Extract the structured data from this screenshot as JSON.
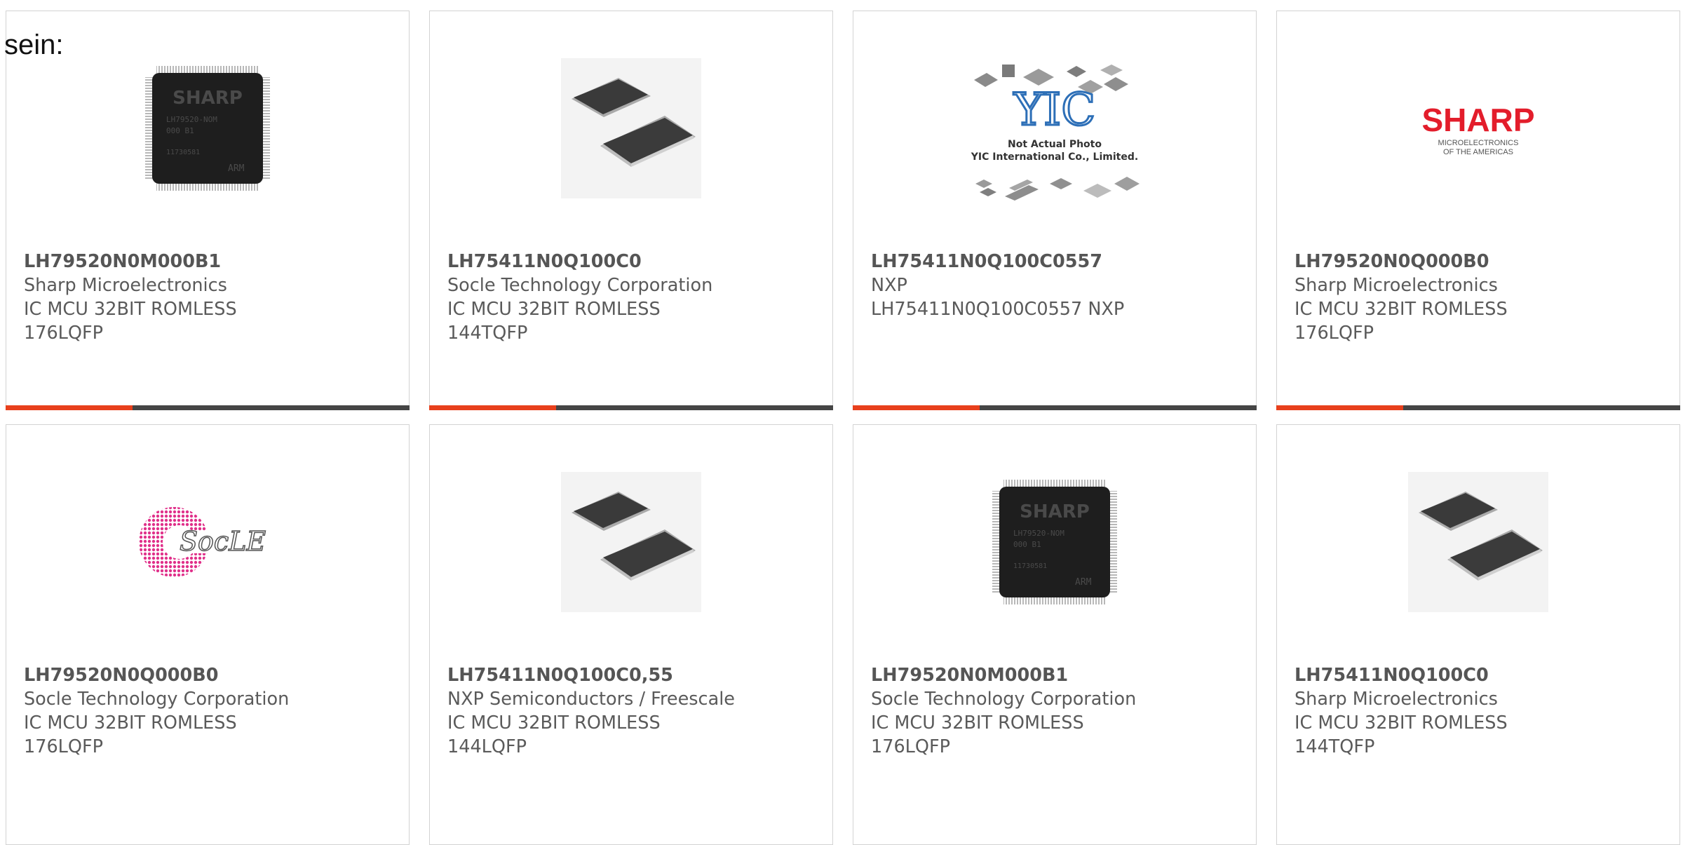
{
  "page": {
    "lead_text": "sein:"
  },
  "colors": {
    "accent": "#e8401c",
    "bar_base": "#454545",
    "card_border": "#d3d3d3",
    "text": "#555555"
  },
  "products": [
    {
      "part_number": "LH79520N0M000B1",
      "manufacturer": "Sharp Microelectronics",
      "description": "IC MCU 32BIT ROMLESS 176LQFP",
      "image_type": "sharp-chip-photo",
      "chip_marking": [
        "SHARP",
        "LH79520-NOM",
        "000 B1",
        "11730581",
        "ARM"
      ],
      "highlight_fraction": 0.315
    },
    {
      "part_number": "LH75411N0Q100C0",
      "manufacturer": "Socle Technology Corporation",
      "description": "IC MCU 32BIT ROMLESS 144TQFP",
      "image_type": "generic-qfp-chips",
      "highlight_fraction": 0.315
    },
    {
      "part_number": "LH75411N0Q100C0557",
      "manufacturer": "NXP",
      "description": "LH75411N0Q100C0557 NXP",
      "image_type": "yic-placeholder",
      "placeholder_logo": "YIC",
      "placeholder_line_1": "Not Actual Photo",
      "placeholder_line_2": "YIC International Co., Limited.",
      "highlight_fraction": 0.315
    },
    {
      "part_number": "LH79520N0Q000B0",
      "manufacturer": "Sharp Microelectronics",
      "description": "IC MCU 32BIT ROMLESS 176LQFP",
      "image_type": "sharp-logo",
      "logo_text": "SHARP",
      "logo_sub_1": "MICROELECTRONICS",
      "logo_sub_2": "OF THE AMERICAS",
      "highlight_fraction": 0.315
    },
    {
      "part_number": "LH79520N0Q000B0",
      "manufacturer": "Socle Technology Corporation",
      "description": "IC MCU 32BIT ROMLESS 176LQFP",
      "image_type": "socle-logo",
      "logo_text": "SocLE"
    },
    {
      "part_number": "LH75411N0Q100C0,55",
      "manufacturer": "NXP Semiconductors / Freescale",
      "description": "IC MCU 32BIT ROMLESS 144LQFP",
      "image_type": "generic-qfp-chips"
    },
    {
      "part_number": "LH79520N0M000B1",
      "manufacturer": "Socle Technology Corporation",
      "description": "IC MCU 32BIT ROMLESS 176LQFP",
      "image_type": "sharp-chip-photo",
      "chip_marking": [
        "SHARP",
        "LH79520-NOM",
        "000 B1",
        "11730581",
        "ARM"
      ]
    },
    {
      "part_number": "LH75411N0Q100C0",
      "manufacturer": "Sharp Microelectronics",
      "description": "IC MCU 32BIT ROMLESS 144TQFP",
      "image_type": "generic-qfp-chips"
    }
  ]
}
